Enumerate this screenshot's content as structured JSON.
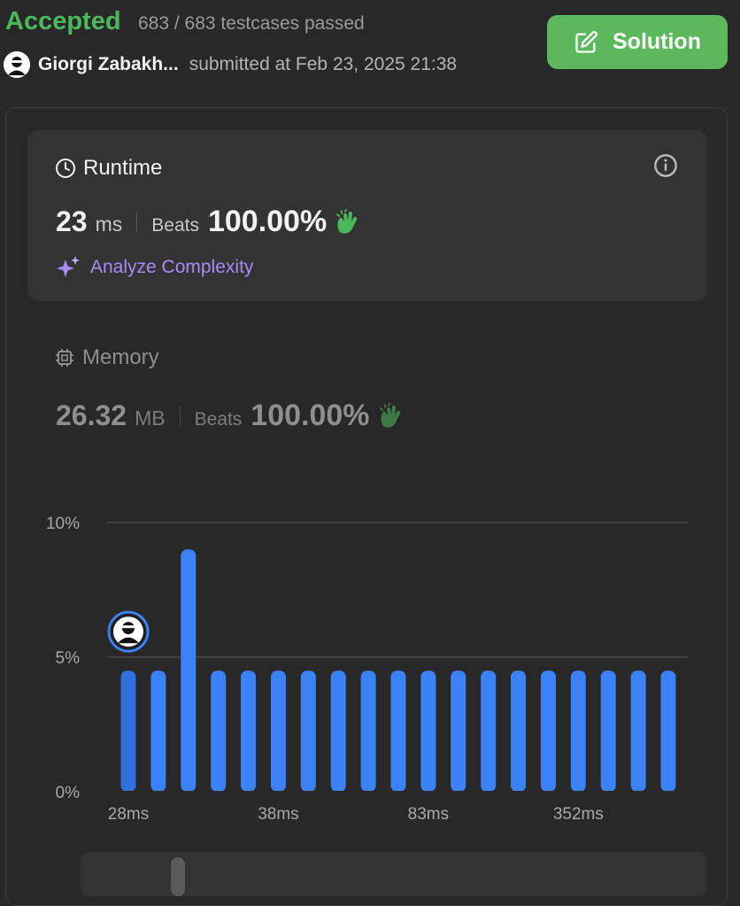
{
  "header": {
    "status": "Accepted",
    "testcases": "683 / 683 testcases passed",
    "username": "Giorgi Zabakh...",
    "submitted": "submitted at Feb 23, 2025 21:38",
    "solution_label": "Solution"
  },
  "runtime": {
    "title": "Runtime",
    "value": "23",
    "unit": "ms",
    "beats_label": "Beats",
    "beats_value": "100.00%",
    "analyze_label": "Analyze Complexity"
  },
  "memory": {
    "title": "Memory",
    "value": "26.32",
    "unit": "MB",
    "beats_label": "Beats",
    "beats_value": "100.00%"
  },
  "colors": {
    "accepted": "#4cb85c",
    "solution_button": "#5cb85c",
    "bar": "#3b82f6",
    "analyze": "#a78bfa"
  },
  "chart_data": {
    "type": "bar",
    "ylim": [
      0,
      10
    ],
    "y_ticks": [
      "0%",
      "5%",
      "10%"
    ],
    "x_tick_labels": [
      "28ms",
      "38ms",
      "83ms",
      "352ms"
    ],
    "x_tick_bar_index": [
      0,
      5,
      10,
      15
    ],
    "values": [
      4.5,
      4.5,
      9.0,
      4.5,
      4.5,
      4.5,
      4.5,
      4.5,
      4.5,
      4.5,
      4.5,
      4.5,
      4.5,
      4.5,
      4.5,
      4.5,
      4.5,
      4.5,
      4.5
    ],
    "user_bar_index": 0,
    "grid": true
  }
}
